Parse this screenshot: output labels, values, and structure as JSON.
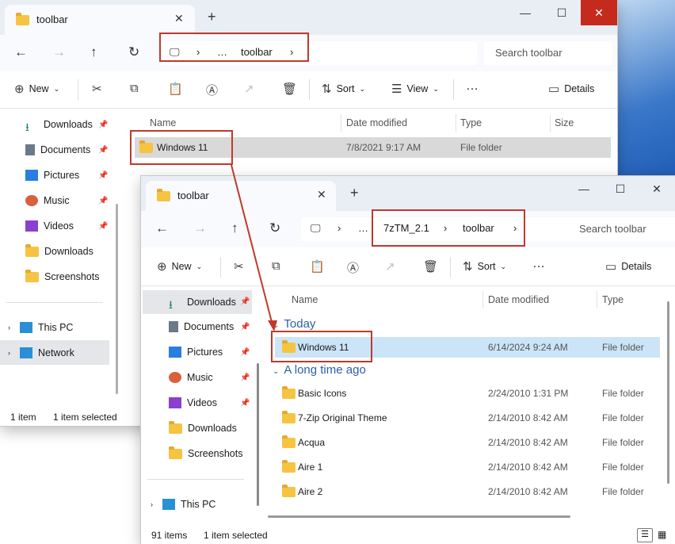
{
  "back_window": {
    "tab_title": "toolbar",
    "breadcrumb": [
      "…",
      "toolbar"
    ],
    "search_placeholder": "Search toolbar",
    "commands": {
      "new": "New",
      "sort": "Sort",
      "view": "View",
      "more": "…",
      "details": "Details"
    },
    "sidebar": [
      {
        "label": "Downloads",
        "icon": "download-icon",
        "pinned": true
      },
      {
        "label": "Documents",
        "icon": "document-icon",
        "pinned": true
      },
      {
        "label": "Pictures",
        "icon": "pictures-icon",
        "pinned": true
      },
      {
        "label": "Music",
        "icon": "music-icon",
        "pinned": true
      },
      {
        "label": "Videos",
        "icon": "videos-icon",
        "pinned": true
      },
      {
        "label": "Downloads",
        "icon": "folder-icon",
        "pinned": false
      },
      {
        "label": "Screenshots",
        "icon": "folder-icon",
        "pinned": false
      }
    ],
    "sidebar_bottom": [
      {
        "label": "This PC",
        "icon": "computer-icon"
      },
      {
        "label": "Network",
        "icon": "network-icon"
      }
    ],
    "columns": [
      "Name",
      "Date modified",
      "Type",
      "Size"
    ],
    "rows": [
      {
        "name": "Windows 11",
        "date": "7/8/2021 9:17 AM",
        "type": "File folder"
      }
    ],
    "status": {
      "count": "1 item",
      "selected": "1 item selected"
    }
  },
  "front_window": {
    "tab_title": "toolbar",
    "breadcrumb": [
      "…",
      "7zTM_2.1",
      "toolbar"
    ],
    "search_placeholder": "Search toolbar",
    "commands": {
      "new": "New",
      "sort": "Sort",
      "more": "…",
      "details": "Details"
    },
    "sidebar": [
      {
        "label": "Downloads",
        "icon": "download-icon",
        "pinned": true
      },
      {
        "label": "Documents",
        "icon": "document-icon",
        "pinned": true
      },
      {
        "label": "Pictures",
        "icon": "pictures-icon",
        "pinned": true
      },
      {
        "label": "Music",
        "icon": "music-icon",
        "pinned": true
      },
      {
        "label": "Videos",
        "icon": "videos-icon",
        "pinned": true
      },
      {
        "label": "Downloads",
        "icon": "folder-icon",
        "pinned": false
      },
      {
        "label": "Screenshots",
        "icon": "folder-icon",
        "pinned": false
      }
    ],
    "sidebar_bottom": [
      {
        "label": "This PC",
        "icon": "computer-icon"
      }
    ],
    "columns": [
      "Name",
      "Date modified",
      "Type"
    ],
    "group_today": "Today",
    "group_old": "A long time ago",
    "today_rows": [
      {
        "name": "Windows 11",
        "date": "6/14/2024 9:24 AM",
        "type": "File folder"
      }
    ],
    "old_rows": [
      {
        "name": "Basic Icons",
        "date": "2/24/2010 1:31 PM",
        "type": "File folder"
      },
      {
        "name": "7-Zip Original Theme",
        "date": "2/14/2010 8:42 AM",
        "type": "File folder"
      },
      {
        "name": "Acqua",
        "date": "2/14/2010 8:42 AM",
        "type": "File folder"
      },
      {
        "name": "Aire 1",
        "date": "2/14/2010 8:42 AM",
        "type": "File folder"
      },
      {
        "name": "Aire 2",
        "date": "2/14/2010 8:42 AM",
        "type": "File folder"
      }
    ],
    "status": {
      "count": "91 items",
      "selected": "1 item selected"
    }
  },
  "colors": {
    "highlight": "#c0392b",
    "selection": "#cce4f7",
    "close_red": "#c42b1c"
  }
}
